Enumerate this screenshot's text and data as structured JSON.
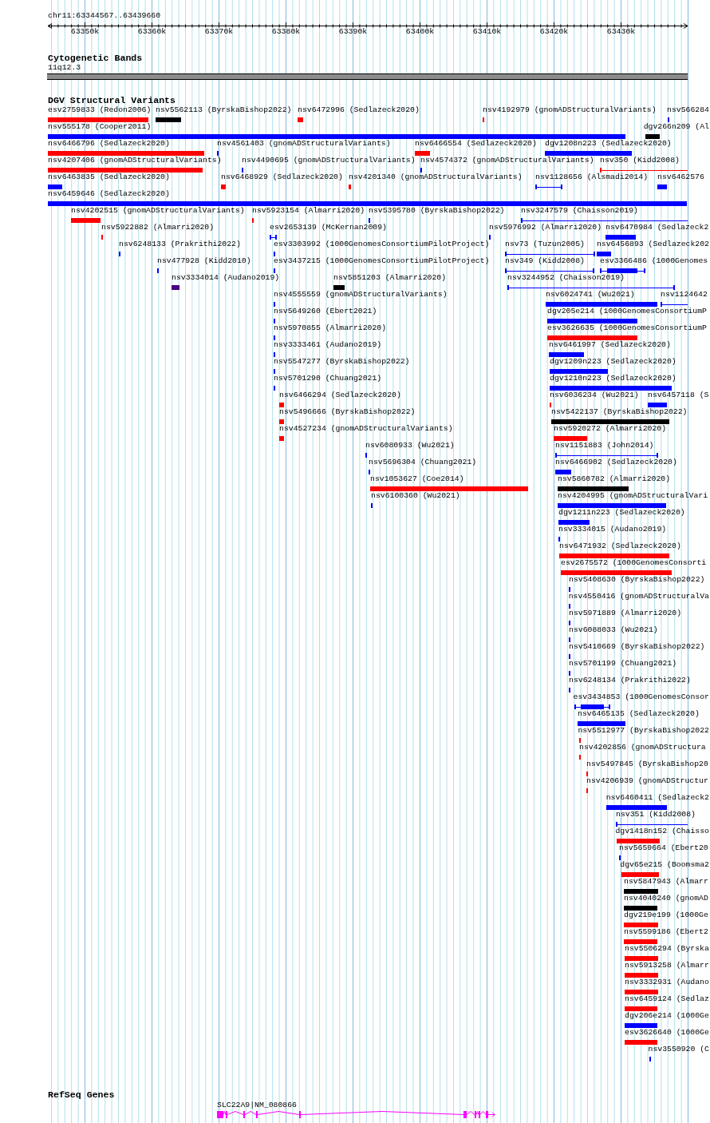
{
  "ruler": {
    "location": "chr11:63344567..63439660",
    "ticks": [
      "63350k",
      "63360k",
      "63370k",
      "63380k",
      "63390k",
      "63400k",
      "63410k",
      "63420k",
      "63430k"
    ]
  },
  "cytogenetic_bands": {
    "title": "Cytogenetic Bands",
    "band": "11q12.3"
  },
  "dgv_track": {
    "title": "DGV Structural Variants",
    "rows": [
      [
        {
          "label": "esv2759833 (Redon2006)",
          "kind": "box",
          "color": "#ff0000"
        },
        {
          "label": "nsv5562113 (ByrskaBishop2022)",
          "kind": "box",
          "color": "#000000"
        },
        {
          "label": "nsv6472996 (Sedlazeck2020)",
          "kind": "box",
          "color": "#ff0000"
        },
        {
          "label": "nsv4192979 (gnomADStructuralVariants)",
          "kind": "box",
          "color": "#ff0000"
        },
        {
          "label": "nsv566284",
          "kind": "box",
          "color": "#0000ff"
        }
      ],
      [
        {
          "label": "nsv555178 (Cooper2011)",
          "kind": "box",
          "color": "#0000ff"
        },
        {
          "label": "dgv266n209 (Al",
          "kind": "box",
          "color": "#000000"
        }
      ],
      [
        {
          "label": "nsv6466796 (Sedlazeck2020)",
          "kind": "box",
          "color": "#ff0000"
        },
        {
          "label": "nsv4561403 (gnomADStructuralVariants)",
          "kind": "box",
          "color": "#0000ff"
        },
        {
          "label": "nsv6466554 (Sedlazeck2020)",
          "kind": "box",
          "color": "#ff0000"
        },
        {
          "label": "dgv1208n223 (Sedlazeck2020)",
          "kind": "box",
          "color": "#0000ff"
        }
      ],
      [
        {
          "label": "nsv4207406 (gnomADStructuralVariants)",
          "kind": "box",
          "color": "#ff0000"
        },
        {
          "label": "nsv4490695 (gnomADStructuralVariants)",
          "kind": "box",
          "color": "#0000ff"
        },
        {
          "label": "nsv4574372 (gnomADStructuralVariants)",
          "kind": "box",
          "color": "#0000ff"
        },
        {
          "label": "nsv350 (Kidd2008)",
          "kind": "line",
          "color": "#ff0000"
        }
      ],
      [
        {
          "label": "nsv6463835 (Sedlazeck2020)",
          "kind": "box",
          "color": "#0000ff"
        },
        {
          "label": "nsv6468929 (Sedlazeck2020)",
          "kind": "box",
          "color": "#ff0000"
        },
        {
          "label": "nsv4201340 (gnomADStructuralVariants)",
          "kind": "box",
          "color": "#ff0000"
        },
        {
          "label": "nsv1128656 (Alsmadi2014)",
          "kind": "line",
          "color": "#0000ff"
        },
        {
          "label": "nsv6462576",
          "kind": "box",
          "color": "#0000ff"
        }
      ],
      [
        {
          "label": "nsv6459646 (Sedlazeck2020)",
          "kind": "box",
          "color": "#0000ff"
        }
      ],
      [
        {
          "label": "nsv4202515 (gnomADStructuralVariants)",
          "kind": "box",
          "color": "#ff0000"
        },
        {
          "label": "nsv5923154 (Almarri2020)",
          "kind": "box",
          "color": "#ff0000"
        },
        {
          "label": "nsv5395780 (ByrskaBishop2022)",
          "kind": "box",
          "color": "#0000ff"
        },
        {
          "label": "nsv3247579 (Chaisson2019)",
          "kind": "line",
          "color": "#0000ff"
        }
      ],
      [
        {
          "label": "nsv5922882 (Almarri2020)",
          "kind": "box",
          "color": "#ff0000"
        },
        {
          "label": "esv2653139 (McKernan2009)",
          "kind": "line",
          "color": "#0000ff"
        },
        {
          "label": "nsv5976992 (Almarri2020)",
          "kind": "box",
          "color": "#0000ff"
        },
        {
          "label": "nsv6470984 (Sedlazeck2",
          "kind": "box",
          "color": "#0000ff"
        }
      ],
      [
        {
          "label": "nsv6248133 (Prakrithi2022)",
          "kind": "box",
          "color": "#0000ff"
        },
        {
          "label": "esv3303992 (1000GenomesConsortiumPilotProject)",
          "kind": "box",
          "color": "#0000ff"
        },
        {
          "label": "nsv73 (Tuzun2005)",
          "kind": "line",
          "color": "#0000ff"
        },
        {
          "label": "nsv6456893 (Sedlazeck202",
          "kind": "box",
          "color": "#0000ff"
        }
      ],
      [
        {
          "label": "nsv477928 (Kidd2010)",
          "kind": "box",
          "color": "#0000ff"
        },
        {
          "label": "esv3437215 (1000GenomesConsortiumPilotProject)",
          "kind": "box",
          "color": "#0000ff"
        },
        {
          "label": "nsv349 (Kidd2008)",
          "kind": "line",
          "color": "#0000ff"
        },
        {
          "label": "esv3366486 (1000Genomes",
          "kind": "line_box",
          "color": "#0000ff"
        }
      ],
      [
        {
          "label": "nsv3334014 (Audano2019)",
          "kind": "box",
          "color": "#4b0082"
        },
        {
          "label": "nsv5851203 (Almarri2020)",
          "kind": "box",
          "color": "#000000"
        },
        {
          "label": "nsv3244952 (Chaisson2019)",
          "kind": "line",
          "color": "#0000ff"
        }
      ],
      [
        {
          "label": "nsv4555559 (gnomADStructuralVariants)",
          "kind": "box",
          "color": "#0000ff"
        },
        {
          "label": "nsv6024741 (Wu2021)",
          "kind": "box",
          "color": "#0000ff"
        },
        {
          "label": "nsv1124642",
          "kind": "line",
          "color": "#0000ff"
        }
      ],
      [
        {
          "label": "nsv5649260 (Ebert2021)",
          "kind": "box",
          "color": "#0000ff"
        },
        {
          "label": "dgv205e214 (1000GenomesConsortiumP",
          "kind": "box",
          "color": "#0000ff"
        }
      ],
      [
        {
          "label": "nsv5970855 (Almarri2020)",
          "kind": "box",
          "color": "#0000ff"
        },
        {
          "label": "esv3626635 (1000GenomesConsortiumP",
          "kind": "box",
          "color": "#ff0000"
        }
      ],
      [
        {
          "label": "nsv3333461 (Audano2019)",
          "kind": "box",
          "color": "#0000ff"
        },
        {
          "label": "nsv6461997 (Sedlazeck2020)",
          "kind": "box",
          "color": "#0000ff"
        }
      ],
      [
        {
          "label": "nsv5547277 (ByrskaBishop2022)",
          "kind": "box",
          "color": "#0000ff"
        },
        {
          "label": "dgv1209n223 (Sedlazeck2020)",
          "kind": "box",
          "color": "#0000ff"
        }
      ],
      [
        {
          "label": "nsv5701290 (Chuang2021)",
          "kind": "box",
          "color": "#0000ff"
        },
        {
          "label": "dgv1210n223 (Sedlazeck2020)",
          "kind": "box",
          "color": "#0000ff"
        }
      ],
      [
        {
          "label": "nsv6466294 (Sedlazeck2020)",
          "kind": "box",
          "color": "#ff0000"
        },
        {
          "label": "nsv6036234 (Wu2021)",
          "kind": "box",
          "color": "#ff0000"
        },
        {
          "label": "nsv6457118 (S",
          "kind": "box",
          "color": "#0000ff"
        }
      ],
      [
        {
          "label": "nsv5496666 (ByrskaBishop2022)",
          "kind": "box",
          "color": "#ff0000"
        },
        {
          "label": "nsv5422137 (ByrskaBishop2022)",
          "kind": "box",
          "color": "#000000"
        }
      ],
      [
        {
          "label": "nsv4527234 (gnomADStructuralVariants)",
          "kind": "box",
          "color": "#ff0000"
        },
        {
          "label": "nsv5920272 (Almarri2020)",
          "kind": "box",
          "color": "#ff0000"
        }
      ],
      [
        {
          "label": "nsv6080933 (Wu2021)",
          "kind": "box",
          "color": "#0000ff"
        },
        {
          "label": "nsv1151883 (John2014)",
          "kind": "line",
          "color": "#0000ff"
        }
      ],
      [
        {
          "label": "nsv5696304 (Chuang2021)",
          "kind": "box",
          "color": "#0000ff"
        },
        {
          "label": "nsv6466902 (Sedlazeck2020)",
          "kind": "box",
          "color": "#0000ff"
        }
      ],
      [
        {
          "label": "nsv1053627 (Coe2014)",
          "kind": "box",
          "color": "#ff0000"
        },
        {
          "label": "nsv5860782 (Almarri2020)",
          "kind": "box",
          "color": "#000000"
        }
      ],
      [
        {
          "label": "nsv6100360 (Wu2021)",
          "kind": "box",
          "color": "#0000ff"
        },
        {
          "label": "nsv4204995 (gnomADStructuralVari",
          "kind": "box",
          "color": "#0000ff"
        }
      ],
      [
        {
          "label": "dgv1211n223 (Sedlazeck2020)",
          "kind": "box",
          "color": "#0000ff"
        }
      ],
      [
        {
          "label": "nsv3334015 (Audano2019)",
          "kind": "box",
          "color": "#0000ff"
        }
      ],
      [
        {
          "label": "nsv6471932 (Sedlazeck2020)",
          "kind": "box",
          "color": "#ff0000"
        }
      ],
      [
        {
          "label": "esv2675572 (1000GenomesConsorti",
          "kind": "box",
          "color": "#ff0000"
        }
      ],
      [
        {
          "label": "nsv5408630 (ByrskaBishop2022)",
          "kind": "box",
          "color": "#0000ff"
        }
      ],
      [
        {
          "label": "nsv4550416 (gnomADStructuralVa",
          "kind": "box",
          "color": "#0000ff"
        }
      ],
      [
        {
          "label": "nsv5971889 (Almarri2020)",
          "kind": "box",
          "color": "#0000ff"
        }
      ],
      [
        {
          "label": "nsv6088033 (Wu2021)",
          "kind": "box",
          "color": "#0000ff"
        }
      ],
      [
        {
          "label": "nsv5410669 (ByrskaBishop2022)",
          "kind": "box",
          "color": "#0000ff"
        }
      ],
      [
        {
          "label": "nsv5701199 (Chuang2021)",
          "kind": "box",
          "color": "#0000ff"
        }
      ],
      [
        {
          "label": "nsv6248134 (Prakrithi2022)",
          "kind": "box",
          "color": "#0000ff"
        }
      ],
      [
        {
          "label": "esv3434853 (1000GenomesConsor",
          "kind": "line_box",
          "color": "#0000ff"
        }
      ],
      [
        {
          "label": "nsv6465135 (Sedlazeck2020)",
          "kind": "box",
          "color": "#0000ff"
        }
      ],
      [
        {
          "label": "nsv5512977 (ByrskaBishop2022",
          "kind": "box",
          "color": "#ff0000"
        }
      ],
      [
        {
          "label": "nsv4202856 (gnomADStructura",
          "kind": "box",
          "color": "#ff0000"
        }
      ],
      [
        {
          "label": "nsv5497845 (ByrskaBishop20",
          "kind": "box",
          "color": "#ff0000"
        }
      ],
      [
        {
          "label": "nsv4206939 (gnomADStructur",
          "kind": "box",
          "color": "#ff0000"
        }
      ],
      [
        {
          "label": "nsv6460411 (Sedlazeck2",
          "kind": "box",
          "color": "#0000ff"
        }
      ],
      [
        {
          "label": "nsv351 (Kidd2008)",
          "kind": "line",
          "color": "#0000ff"
        }
      ],
      [
        {
          "label": "dgv1418n152 (Chaisso",
          "kind": "box",
          "color": "#ff0000"
        }
      ],
      [
        {
          "label": "nsv5659664 (Ebert20",
          "kind": "box",
          "color": "#0000ff"
        }
      ],
      [
        {
          "label": "dgv65e215 (Boomsma2",
          "kind": "box",
          "color": "#ff0000"
        }
      ],
      [
        {
          "label": "nsv5847943 (Almarr",
          "kind": "box",
          "color": "#000000"
        }
      ],
      [
        {
          "label": "nsv4040240 (gnomAD",
          "kind": "box",
          "color": "#000000"
        }
      ],
      [
        {
          "label": "dgv219e199 (1000Ge",
          "kind": "box",
          "color": "#ff0000"
        }
      ],
      [
        {
          "label": "nsv5599186 (Ebert2",
          "kind": "box",
          "color": "#ff0000"
        }
      ],
      [
        {
          "label": "nsv5506294 (Byrska",
          "kind": "box",
          "color": "#ff0000"
        }
      ],
      [
        {
          "label": "nsv5913258 (Almarr",
          "kind": "box",
          "color": "#ff0000"
        }
      ],
      [
        {
          "label": "nsv3332931 (Audano",
          "kind": "box",
          "color": "#ff0000"
        }
      ],
      [
        {
          "label": "nsv6459124 (Sedlaz",
          "kind": "box",
          "color": "#ff0000"
        }
      ],
      [
        {
          "label": "dgv206e214 (1000Ge",
          "kind": "box",
          "color": "#0000ff"
        }
      ],
      [
        {
          "label": "esv3626640 (1000Ge",
          "kind": "box",
          "color": "#ff0000"
        }
      ],
      [
        {
          "label": "nsv3550920 (C",
          "kind": "box",
          "color": "#0000ff"
        }
      ]
    ]
  },
  "refseq_genes": {
    "title": "RefSeq Genes",
    "genes": [
      {
        "label": "SLC22A9|NM_080866"
      }
    ]
  }
}
